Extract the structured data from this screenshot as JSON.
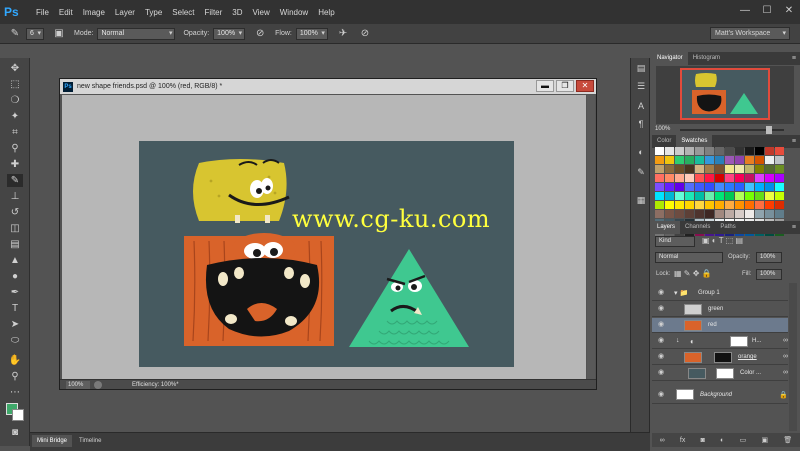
{
  "menubar": {
    "logo": "Ps",
    "items": [
      "File",
      "Edit",
      "Image",
      "Layer",
      "Type",
      "Select",
      "Filter",
      "3D",
      "View",
      "Window",
      "Help"
    ],
    "minimize": "—",
    "maximize": "☐",
    "close": "✕"
  },
  "options": {
    "brush_size": "6",
    "mode_label": "Mode:",
    "mode_value": "Normal",
    "opacity_label": "Opacity:",
    "opacity_value": "100%",
    "flow_label": "Flow:",
    "flow_value": "100%",
    "workspace": "Matt's Workspace"
  },
  "document": {
    "title": "new shape friends.psd @ 100% (red, RGB/8) *",
    "zoom": "100%",
    "status": "Efficiency: 100%*",
    "minimize": "▬",
    "restore": "❐",
    "close": "✕"
  },
  "watermark": "www.cg-ku.com",
  "bottom_tabs": [
    "Mini Bridge",
    "Timeline"
  ],
  "navigator": {
    "tabs": [
      "Navigator",
      "Histogram"
    ],
    "zoom": "100%"
  },
  "swatches_panel": {
    "tabs": [
      "Color",
      "Swatches"
    ],
    "colors": [
      "#ffffff",
      "#e6e6e6",
      "#cccccc",
      "#b3b3b3",
      "#999999",
      "#808080",
      "#666666",
      "#4d4d4d",
      "#333333",
      "#1a1a1a",
      "#000000",
      "#c0392b",
      "#e74c3c",
      "#f39c12",
      "#f1c40f",
      "#2ecc71",
      "#27ae60",
      "#1abc9c",
      "#3498db",
      "#2980b9",
      "#9b59b6",
      "#8e44ad",
      "#e67e22",
      "#d35400",
      "#ecf0f1",
      "#bdc3c7",
      "#c0a16b",
      "#8b6b3d",
      "#6b4f2a",
      "#4a3520",
      "#d4b483",
      "#a47c48",
      "#7a5230",
      "#f0e68c",
      "#eee8aa",
      "#bdb76b",
      "#808000",
      "#556b2f",
      "#6b8e23",
      "#ff6f61",
      "#ff8a65",
      "#ffab91",
      "#ffccbc",
      "#ff5252",
      "#ff1744",
      "#d50000",
      "#ff4081",
      "#f50057",
      "#c51162",
      "#e040fb",
      "#d500f9",
      "#aa00ff",
      "#7c4dff",
      "#651fff",
      "#6200ea",
      "#536dfe",
      "#3d5afe",
      "#304ffe",
      "#448aff",
      "#2979ff",
      "#2962ff",
      "#40c4ff",
      "#00b0ff",
      "#0091ea",
      "#18ffff",
      "#00e5ff",
      "#00b8d4",
      "#64ffda",
      "#1de9b6",
      "#00bfa5",
      "#69f0ae",
      "#00e676",
      "#00c853",
      "#b2ff59",
      "#76ff03",
      "#64dd17",
      "#eeff41",
      "#c6ff00",
      "#aeea00",
      "#ffff00",
      "#ffea00",
      "#ffd600",
      "#ffd740",
      "#ffc400",
      "#ffab00",
      "#ffab40",
      "#ff9100",
      "#ff6d00",
      "#ff6e40",
      "#ff3d00",
      "#dd2c00",
      "#8d6e63",
      "#795548",
      "#6d4c41",
      "#5d4037",
      "#4e342e",
      "#3e2723",
      "#a1887f",
      "#bcaaa4",
      "#d7ccc8",
      "#efebe9",
      "#90a4ae",
      "#78909c",
      "#607d8b",
      "#546e7a",
      "#455a64",
      "#37474f",
      "#263238",
      "#b0bec5",
      "#cfd8dc",
      "#eceff1",
      "#fafafa",
      "#f5f5f5",
      "#eeeeee",
      "#e0e0e0",
      "#bdbdbd",
      "#9e9e9e",
      "#757575",
      "#616161",
      "#424242",
      "#212121",
      "#880e4f",
      "#4a148c",
      "#311b92",
      "#1a237e",
      "#0d47a1",
      "#01579b",
      "#006064",
      "#004d40",
      "#1b5e20"
    ]
  },
  "layers_panel": {
    "tabs": [
      "Layers",
      "Channels",
      "Paths"
    ],
    "filter_kind": "Kind",
    "blend_mode": "Normal",
    "opacity_label": "Opacity:",
    "opacity_value": "100%",
    "lock_label": "Lock:",
    "fill_label": "Fill:",
    "fill_value": "100%",
    "layers": [
      {
        "name": "Group 1"
      },
      {
        "name": "green"
      },
      {
        "name": "red"
      },
      {
        "name": "H..."
      },
      {
        "name": "orange"
      },
      {
        "name": "Color ..."
      },
      {
        "name": "Background"
      }
    ]
  }
}
